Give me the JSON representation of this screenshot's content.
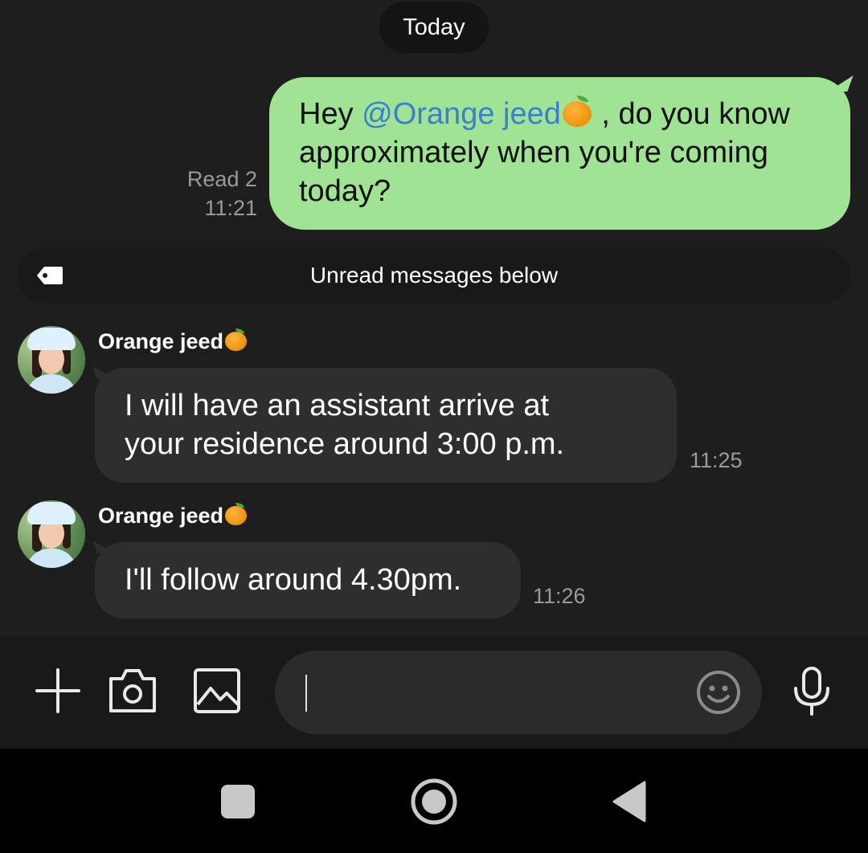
{
  "date_chip": "Today",
  "outgoing": {
    "text_before": "Hey ",
    "mention": "@Orange jeed",
    "text_after": " , do you know approximately when you're coming today?",
    "read_status": "Read 2",
    "time": "11:21",
    "bubble_color": "#a0e394",
    "mention_color": "#3a7fd0"
  },
  "unread_divider": {
    "label": "Unread messages below",
    "icon": "tag-icon"
  },
  "messages": [
    {
      "sender": "Orange jeed",
      "text_line1": "I will have an assistant arrive at",
      "text_line2": "your residence around 3:00 p.m.",
      "time": "11:25"
    },
    {
      "sender": "Orange jeed",
      "text_line1": "I'll follow around 4.30pm.",
      "time": "11:26"
    }
  ],
  "input_bar": {
    "placeholder": "",
    "tools": [
      "plus-icon",
      "camera-icon",
      "image-icon"
    ],
    "emoji_icon": "smiley-icon",
    "mic_icon": "microphone-icon"
  },
  "nav_bar": {
    "buttons": [
      "recents-square-icon",
      "home-circle-icon",
      "back-triangle-icon"
    ]
  },
  "colors": {
    "background": "#1e1e1e",
    "incoming_bubble": "#2e2e2e",
    "timestamp": "#9a9a9a"
  }
}
